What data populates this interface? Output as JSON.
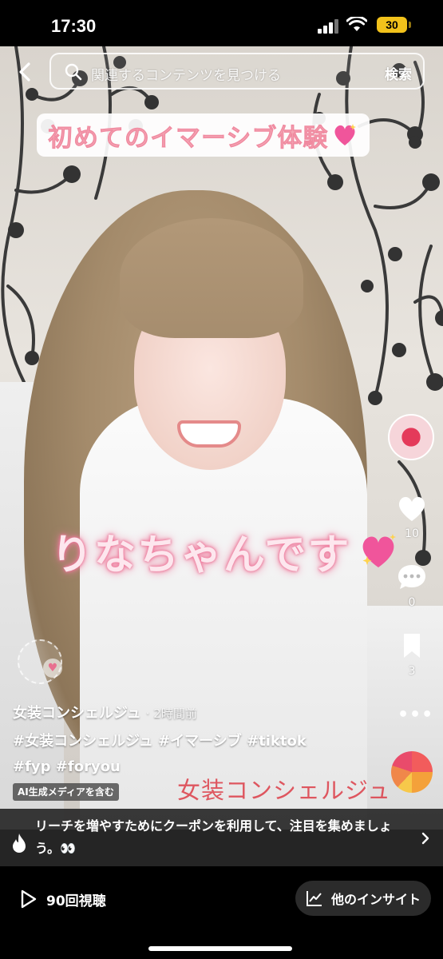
{
  "status_bar": {
    "time": "17:30",
    "battery": "30"
  },
  "search": {
    "placeholder": "関連するコンテンツを見つける",
    "button": "検索"
  },
  "video": {
    "title_overlay": "初めてのイマーシブ体験",
    "name_overlay": "りなちゃんです",
    "watermark": "女装コンシェルジュ"
  },
  "rail": {
    "likes": "10",
    "comments": "0",
    "saves": "3"
  },
  "caption": {
    "author": "女装コンシェルジュ",
    "time_ago": "· 2時間前",
    "hashtags_line1": "#女装コンシェルジュ #イマーシブ #tiktok",
    "hashtags_line2": "#fyp #foryou",
    "ai_label": "AI生成メディアを含む"
  },
  "promo": {
    "text": "リーチを増やすためにクーポンを利用して、注目を集めましょう。👀"
  },
  "bottom": {
    "views": "90回視聴",
    "insights": "他のインサイト"
  },
  "colors": {
    "accent_pink": "#f4a7b5",
    "background": "#000000",
    "battery": "#f2c21b"
  }
}
